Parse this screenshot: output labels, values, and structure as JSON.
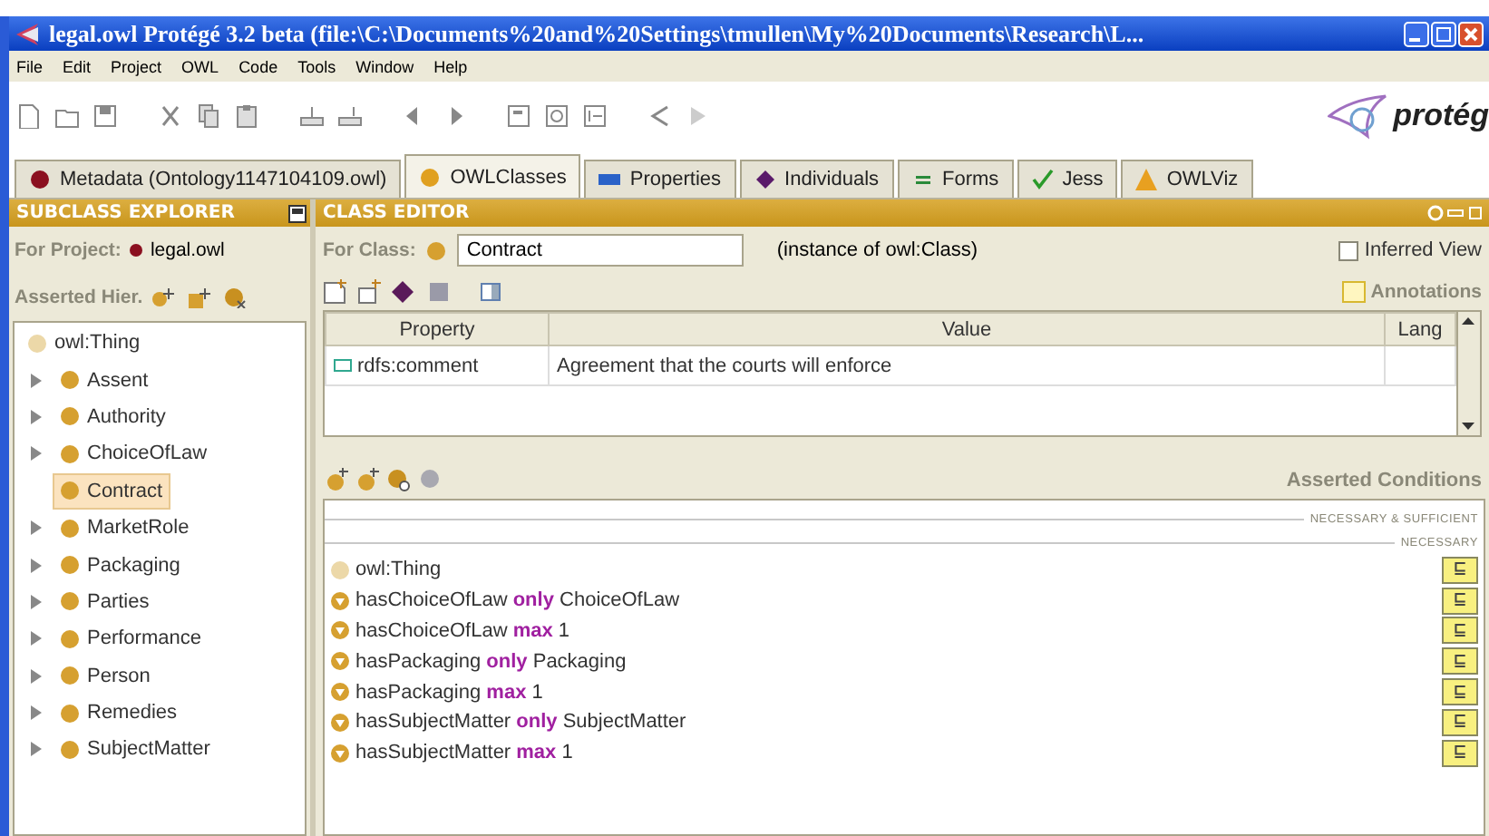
{
  "window": {
    "title": "legal.owl  Protégé 3.2 beta   (file:\\C:\\Documents%20and%20Settings\\tmullen\\My%20Documents\\Research\\L..."
  },
  "menu": [
    "File",
    "Edit",
    "Project",
    "OWL",
    "Code",
    "Tools",
    "Window",
    "Help"
  ],
  "logo": {
    "text": "protég"
  },
  "tabs": [
    {
      "label": "Metadata (Ontology1147104109.owl)",
      "kind": "dot",
      "color": "#8b1020",
      "selected": false
    },
    {
      "label": "OWLClasses",
      "kind": "dot",
      "color": "#e0a020",
      "selected": true
    },
    {
      "label": "Properties",
      "kind": "bar",
      "color": "#2a62c8",
      "selected": false
    },
    {
      "label": "Individuals",
      "kind": "diamond",
      "color": "#5a1a6a",
      "selected": false
    },
    {
      "label": "Forms",
      "kind": "equals",
      "color": "#2a8a3a",
      "selected": false
    },
    {
      "label": "Jess",
      "kind": "check",
      "color": "#2a9a2a",
      "selected": false
    },
    {
      "label": "OWLViz",
      "kind": "triangle",
      "color": "#e8a020",
      "selected": false
    }
  ],
  "subclass_explorer": {
    "title": "SUBCLASS EXPLORER",
    "project_label": "For Project:",
    "project": "legal.owl",
    "hierarchy_label": "Asserted Hier.",
    "tree": [
      {
        "label": "owl:Thing",
        "kind": "root",
        "selected": false,
        "children": [
          {
            "label": "Assent",
            "expandable": true,
            "selected": false
          },
          {
            "label": "Authority",
            "expandable": true,
            "selected": false
          },
          {
            "label": "ChoiceOfLaw",
            "expandable": true,
            "selected": false
          },
          {
            "label": "Contract",
            "expandable": false,
            "selected": true
          },
          {
            "label": "MarketRole",
            "expandable": true,
            "selected": false
          },
          {
            "label": "Packaging",
            "expandable": true,
            "selected": false
          },
          {
            "label": "Parties",
            "expandable": true,
            "selected": false
          },
          {
            "label": "Performance",
            "expandable": true,
            "selected": false
          },
          {
            "label": "Person",
            "expandable": true,
            "selected": false
          },
          {
            "label": "Remedies",
            "expandable": true,
            "selected": false
          },
          {
            "label": "SubjectMatter",
            "expandable": true,
            "selected": false
          }
        ]
      }
    ]
  },
  "class_editor": {
    "title": "CLASS EDITOR",
    "class_label": "For Class:",
    "class_name": "Contract",
    "instance_of": "(instance of owl:Class)",
    "inferred_view": {
      "label": "Inferred View",
      "checked": false
    },
    "annotations_label": "Annotations",
    "table": {
      "columns": [
        "Property",
        "Value",
        "Lang"
      ],
      "rows": [
        {
          "property": "rdfs:comment",
          "value": "Agreement that the courts will enforce"
        }
      ]
    },
    "conditions_title": "Asserted Conditions",
    "sections": [
      "NECESSARY & SUFFICIENT",
      "NECESSARY"
    ],
    "conditions": [
      {
        "text": "owl:Thing",
        "kind": "named",
        "badge": "⊑"
      },
      {
        "text": "hasChoiceOfLaw **only** ChoiceOfLaw",
        "kind": "restriction",
        "badge": "⊑"
      },
      {
        "text": "hasChoiceOfLaw **max** 1",
        "kind": "restriction",
        "badge": "⊑"
      },
      {
        "text": "hasPackaging **only** Packaging",
        "kind": "restriction",
        "badge": "⊑"
      },
      {
        "text": "hasPackaging **max** 1",
        "kind": "restriction",
        "badge": "⊑"
      },
      {
        "text": "hasSubjectMatter **only** SubjectMatter",
        "kind": "restriction",
        "badge": "⊑"
      },
      {
        "text": "hasSubjectMatter **max** 1",
        "kind": "restriction",
        "badge": "⊑"
      }
    ]
  }
}
